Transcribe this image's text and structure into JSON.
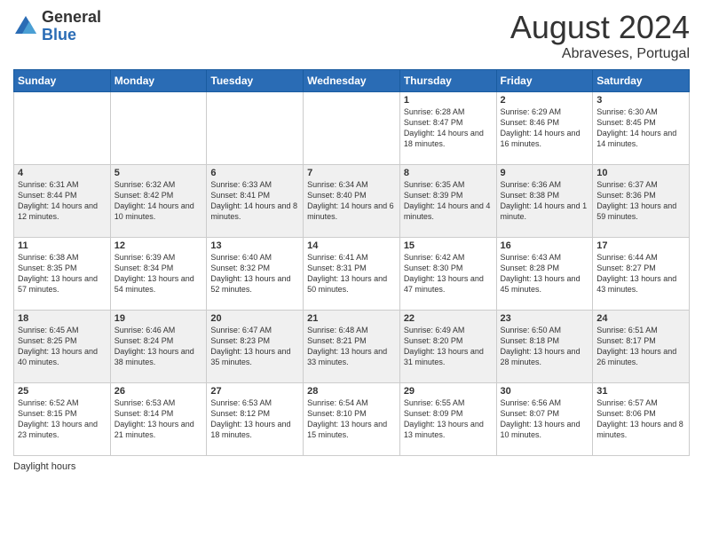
{
  "header": {
    "logo_general": "General",
    "logo_blue": "Blue",
    "month_title": "August 2024",
    "location": "Abraveses, Portugal"
  },
  "days_of_week": [
    "Sunday",
    "Monday",
    "Tuesday",
    "Wednesday",
    "Thursday",
    "Friday",
    "Saturday"
  ],
  "legend": {
    "daylight_hours": "Daylight hours"
  },
  "weeks": [
    [
      {
        "day": "",
        "sunrise": "",
        "sunset": "",
        "daylight": ""
      },
      {
        "day": "",
        "sunrise": "",
        "sunset": "",
        "daylight": ""
      },
      {
        "day": "",
        "sunrise": "",
        "sunset": "",
        "daylight": ""
      },
      {
        "day": "",
        "sunrise": "",
        "sunset": "",
        "daylight": ""
      },
      {
        "day": "1",
        "sunrise": "Sunrise: 6:28 AM",
        "sunset": "Sunset: 8:47 PM",
        "daylight": "Daylight: 14 hours and 18 minutes."
      },
      {
        "day": "2",
        "sunrise": "Sunrise: 6:29 AM",
        "sunset": "Sunset: 8:46 PM",
        "daylight": "Daylight: 14 hours and 16 minutes."
      },
      {
        "day": "3",
        "sunrise": "Sunrise: 6:30 AM",
        "sunset": "Sunset: 8:45 PM",
        "daylight": "Daylight: 14 hours and 14 minutes."
      }
    ],
    [
      {
        "day": "4",
        "sunrise": "Sunrise: 6:31 AM",
        "sunset": "Sunset: 8:44 PM",
        "daylight": "Daylight: 14 hours and 12 minutes."
      },
      {
        "day": "5",
        "sunrise": "Sunrise: 6:32 AM",
        "sunset": "Sunset: 8:42 PM",
        "daylight": "Daylight: 14 hours and 10 minutes."
      },
      {
        "day": "6",
        "sunrise": "Sunrise: 6:33 AM",
        "sunset": "Sunset: 8:41 PM",
        "daylight": "Daylight: 14 hours and 8 minutes."
      },
      {
        "day": "7",
        "sunrise": "Sunrise: 6:34 AM",
        "sunset": "Sunset: 8:40 PM",
        "daylight": "Daylight: 14 hours and 6 minutes."
      },
      {
        "day": "8",
        "sunrise": "Sunrise: 6:35 AM",
        "sunset": "Sunset: 8:39 PM",
        "daylight": "Daylight: 14 hours and 4 minutes."
      },
      {
        "day": "9",
        "sunrise": "Sunrise: 6:36 AM",
        "sunset": "Sunset: 8:38 PM",
        "daylight": "Daylight: 14 hours and 1 minute."
      },
      {
        "day": "10",
        "sunrise": "Sunrise: 6:37 AM",
        "sunset": "Sunset: 8:36 PM",
        "daylight": "Daylight: 13 hours and 59 minutes."
      }
    ],
    [
      {
        "day": "11",
        "sunrise": "Sunrise: 6:38 AM",
        "sunset": "Sunset: 8:35 PM",
        "daylight": "Daylight: 13 hours and 57 minutes."
      },
      {
        "day": "12",
        "sunrise": "Sunrise: 6:39 AM",
        "sunset": "Sunset: 8:34 PM",
        "daylight": "Daylight: 13 hours and 54 minutes."
      },
      {
        "day": "13",
        "sunrise": "Sunrise: 6:40 AM",
        "sunset": "Sunset: 8:32 PM",
        "daylight": "Daylight: 13 hours and 52 minutes."
      },
      {
        "day": "14",
        "sunrise": "Sunrise: 6:41 AM",
        "sunset": "Sunset: 8:31 PM",
        "daylight": "Daylight: 13 hours and 50 minutes."
      },
      {
        "day": "15",
        "sunrise": "Sunrise: 6:42 AM",
        "sunset": "Sunset: 8:30 PM",
        "daylight": "Daylight: 13 hours and 47 minutes."
      },
      {
        "day": "16",
        "sunrise": "Sunrise: 6:43 AM",
        "sunset": "Sunset: 8:28 PM",
        "daylight": "Daylight: 13 hours and 45 minutes."
      },
      {
        "day": "17",
        "sunrise": "Sunrise: 6:44 AM",
        "sunset": "Sunset: 8:27 PM",
        "daylight": "Daylight: 13 hours and 43 minutes."
      }
    ],
    [
      {
        "day": "18",
        "sunrise": "Sunrise: 6:45 AM",
        "sunset": "Sunset: 8:25 PM",
        "daylight": "Daylight: 13 hours and 40 minutes."
      },
      {
        "day": "19",
        "sunrise": "Sunrise: 6:46 AM",
        "sunset": "Sunset: 8:24 PM",
        "daylight": "Daylight: 13 hours and 38 minutes."
      },
      {
        "day": "20",
        "sunrise": "Sunrise: 6:47 AM",
        "sunset": "Sunset: 8:23 PM",
        "daylight": "Daylight: 13 hours and 35 minutes."
      },
      {
        "day": "21",
        "sunrise": "Sunrise: 6:48 AM",
        "sunset": "Sunset: 8:21 PM",
        "daylight": "Daylight: 13 hours and 33 minutes."
      },
      {
        "day": "22",
        "sunrise": "Sunrise: 6:49 AM",
        "sunset": "Sunset: 8:20 PM",
        "daylight": "Daylight: 13 hours and 31 minutes."
      },
      {
        "day": "23",
        "sunrise": "Sunrise: 6:50 AM",
        "sunset": "Sunset: 8:18 PM",
        "daylight": "Daylight: 13 hours and 28 minutes."
      },
      {
        "day": "24",
        "sunrise": "Sunrise: 6:51 AM",
        "sunset": "Sunset: 8:17 PM",
        "daylight": "Daylight: 13 hours and 26 minutes."
      }
    ],
    [
      {
        "day": "25",
        "sunrise": "Sunrise: 6:52 AM",
        "sunset": "Sunset: 8:15 PM",
        "daylight": "Daylight: 13 hours and 23 minutes."
      },
      {
        "day": "26",
        "sunrise": "Sunrise: 6:53 AM",
        "sunset": "Sunset: 8:14 PM",
        "daylight": "Daylight: 13 hours and 21 minutes."
      },
      {
        "day": "27",
        "sunrise": "Sunrise: 6:53 AM",
        "sunset": "Sunset: 8:12 PM",
        "daylight": "Daylight: 13 hours and 18 minutes."
      },
      {
        "day": "28",
        "sunrise": "Sunrise: 6:54 AM",
        "sunset": "Sunset: 8:10 PM",
        "daylight": "Daylight: 13 hours and 15 minutes."
      },
      {
        "day": "29",
        "sunrise": "Sunrise: 6:55 AM",
        "sunset": "Sunset: 8:09 PM",
        "daylight": "Daylight: 13 hours and 13 minutes."
      },
      {
        "day": "30",
        "sunrise": "Sunrise: 6:56 AM",
        "sunset": "Sunset: 8:07 PM",
        "daylight": "Daylight: 13 hours and 10 minutes."
      },
      {
        "day": "31",
        "sunrise": "Sunrise: 6:57 AM",
        "sunset": "Sunset: 8:06 PM",
        "daylight": "Daylight: 13 hours and 8 minutes."
      }
    ]
  ]
}
